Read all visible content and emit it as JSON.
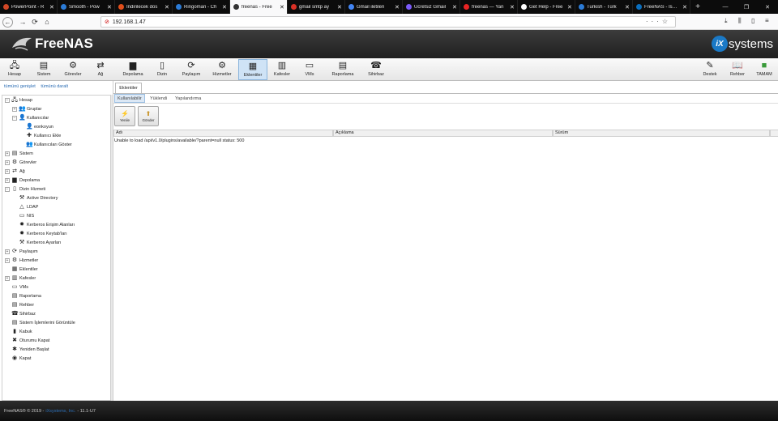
{
  "browser": {
    "tabs": [
      {
        "label": "PowerPoint - R",
        "color": "#d24726",
        "active": false
      },
      {
        "label": "Smooth - Pow",
        "color": "#2b7bd6",
        "active": false
      },
      {
        "label": "İndirilecek dos",
        "color": "#e04e1b",
        "active": false
      },
      {
        "label": "Ringoman - Ch",
        "color": "#2b7bd6",
        "active": false
      },
      {
        "label": "freenas - Free",
        "color": "#333333",
        "active": true
      },
      {
        "label": "gmail smtp ay",
        "color": "#d93025",
        "active": false
      },
      {
        "label": "Gmail iletileri",
        "color": "#4285f4",
        "active": false
      },
      {
        "label": "Ücretsiz Gmail",
        "color": "#7a5af8",
        "active": false
      },
      {
        "label": "freenas — Yan",
        "color": "#e82323",
        "active": false
      },
      {
        "label": "Get Help - Free",
        "color": "#ffffff",
        "active": false
      },
      {
        "label": "Turkish - Türk",
        "color": "#2b7bd6",
        "active": false
      },
      {
        "label": "FreeNAS - İsmail",
        "color": "#0a6ebd",
        "active": false
      }
    ],
    "url": "192.168.1.47"
  },
  "header": {
    "brand": "FreeNAS",
    "vendor": "systems",
    "vendor_mark": "iX"
  },
  "toolbar": {
    "left": [
      {
        "label": "Hesap",
        "icon": "account-icon",
        "glyph": "🖧"
      },
      {
        "label": "Sistem",
        "icon": "system-icon",
        "glyph": "▤"
      },
      {
        "label": "Görevler",
        "icon": "tasks-icon",
        "glyph": "⚙"
      },
      {
        "label": "Ağ",
        "icon": "network-icon",
        "glyph": "⇄"
      },
      {
        "label": "Depolama",
        "icon": "storage-icon",
        "glyph": "▆"
      },
      {
        "label": "Dizin",
        "icon": "directory-icon",
        "glyph": "▯"
      },
      {
        "label": "Paylaşım",
        "icon": "sharing-icon",
        "glyph": "⟳"
      },
      {
        "label": "Hizmetler",
        "icon": "services-icon",
        "glyph": "⚙"
      },
      {
        "label": "Eklentiler",
        "icon": "plugins-icon",
        "glyph": "▦"
      },
      {
        "label": "Kafesler",
        "icon": "jails-icon",
        "glyph": "▥"
      },
      {
        "label": "VMs",
        "icon": "vms-icon",
        "glyph": "▭"
      },
      {
        "label": "Raporlama",
        "icon": "reporting-icon",
        "glyph": "▤"
      },
      {
        "label": "Sihirbaz",
        "icon": "wizard-icon",
        "glyph": "☎"
      }
    ],
    "active": "Eklentiler",
    "right": [
      {
        "label": "Destek",
        "icon": "support-icon",
        "glyph": "✎"
      },
      {
        "label": "Rehber",
        "icon": "guide-icon",
        "glyph": "📖"
      },
      {
        "label": "TAMAM",
        "icon": "ok-icon",
        "glyph": "■"
      }
    ]
  },
  "sidebar": {
    "expand_all": "tümünü genişlet",
    "collapse_all": "tümünü daralt",
    "tree": [
      {
        "label": "Hesap",
        "depth": 0,
        "toggle": "−",
        "icon": "account-icon",
        "glyph": "🖧"
      },
      {
        "label": "Gruplar",
        "depth": 1,
        "toggle": "+",
        "icon": "groups-icon",
        "glyph": "👥"
      },
      {
        "label": "Kullanıcılar",
        "depth": 1,
        "toggle": "−",
        "icon": "users-icon",
        "glyph": "👤"
      },
      {
        "label": "eonkoyun",
        "depth": 2,
        "toggle": "",
        "icon": "user-icon",
        "glyph": "👤"
      },
      {
        "label": "Kullanıcı Ekle",
        "depth": 2,
        "toggle": "",
        "icon": "add-user-icon",
        "glyph": "✚"
      },
      {
        "label": "Kullanıcıları Göster",
        "depth": 2,
        "toggle": "",
        "icon": "list-users-icon",
        "glyph": "👥"
      },
      {
        "label": "Sistem",
        "depth": 0,
        "toggle": "+",
        "icon": "system-icon",
        "glyph": "▤"
      },
      {
        "label": "Görevler",
        "depth": 0,
        "toggle": "+",
        "icon": "tasks-icon",
        "glyph": "⚙"
      },
      {
        "label": "Ağ",
        "depth": 0,
        "toggle": "+",
        "icon": "network-icon",
        "glyph": "⇄"
      },
      {
        "label": "Depolama",
        "depth": 0,
        "toggle": "+",
        "icon": "storage-icon",
        "glyph": "▆"
      },
      {
        "label": "Dizin Hizmeti",
        "depth": 0,
        "toggle": "−",
        "icon": "directory-icon",
        "glyph": "▯"
      },
      {
        "label": "Active Directory",
        "depth": 1,
        "toggle": "",
        "icon": "active-directory-icon",
        "glyph": "⚒"
      },
      {
        "label": "LDAP",
        "depth": 1,
        "toggle": "",
        "icon": "ldap-icon",
        "glyph": "△"
      },
      {
        "label": "NIS",
        "depth": 1,
        "toggle": "",
        "icon": "nis-icon",
        "glyph": "▭"
      },
      {
        "label": "Kerberos Erişim Alanları",
        "depth": 1,
        "toggle": "",
        "icon": "kerberos-icon",
        "glyph": "✹"
      },
      {
        "label": "Kerberos Keytab'ları",
        "depth": 1,
        "toggle": "",
        "icon": "kerberos-icon",
        "glyph": "✹"
      },
      {
        "label": "Kerberos Ayarları",
        "depth": 1,
        "toggle": "",
        "icon": "settings-icon",
        "glyph": "⚒"
      },
      {
        "label": "Paylaşım",
        "depth": 0,
        "toggle": "+",
        "icon": "sharing-icon",
        "glyph": "⟳"
      },
      {
        "label": "Hizmetler",
        "depth": 0,
        "toggle": "+",
        "icon": "services-icon",
        "glyph": "⚙"
      },
      {
        "label": "Eklentiler",
        "depth": 0,
        "toggle": "",
        "icon": "plugins-icon",
        "glyph": "▦"
      },
      {
        "label": "Kafesler",
        "depth": 0,
        "toggle": "+",
        "icon": "jails-icon",
        "glyph": "▥"
      },
      {
        "label": "VMs",
        "depth": 0,
        "toggle": "",
        "icon": "vms-icon",
        "glyph": "▭"
      },
      {
        "label": "Raporlama",
        "depth": 0,
        "toggle": "",
        "icon": "reporting-icon",
        "glyph": "▤"
      },
      {
        "label": "Rehber",
        "depth": 0,
        "toggle": "",
        "icon": "guide-icon",
        "glyph": "▤"
      },
      {
        "label": "Sihirbaz",
        "depth": 0,
        "toggle": "",
        "icon": "wizard-icon",
        "glyph": "☎"
      },
      {
        "label": "Sistem İşlemlerini Görüntüle",
        "depth": 0,
        "toggle": "",
        "icon": "processes-icon",
        "glyph": "▤"
      },
      {
        "label": "Kabuk",
        "depth": 0,
        "toggle": "",
        "icon": "shell-icon",
        "glyph": "▮"
      },
      {
        "label": "Oturumu Kapat",
        "depth": 0,
        "toggle": "",
        "icon": "logout-icon",
        "glyph": "✖"
      },
      {
        "label": "Yeniden Başlat",
        "depth": 0,
        "toggle": "",
        "icon": "reboot-icon",
        "glyph": "✱"
      },
      {
        "label": "Kapat",
        "depth": 0,
        "toggle": "",
        "icon": "shutdown-icon",
        "glyph": "◉"
      }
    ]
  },
  "main": {
    "tab": "Eklentiler",
    "subtabs": [
      "Kullanılabilir",
      "Yüklendi",
      "Yapılandırma"
    ],
    "active_subtab": "Kullanılabilir",
    "buttons": [
      {
        "label": "Yenile",
        "icon": "refresh-icon",
        "glyph": "⚡"
      },
      {
        "label": "Gönder",
        "icon": "upload-icon",
        "glyph": "⬆"
      }
    ],
    "columns": [
      "Adı",
      "Açıklama",
      "Sürüm"
    ],
    "error": "Unable to load /api/v1.0/plugins/available/?parent=null status: 500"
  },
  "footer": {
    "copyright": "FreeNAS® © 2019 -",
    "company": "iXsystems, Inc.",
    "version": "- 11.1-U7"
  },
  "colors": {
    "header_bg": "#2b2b2b",
    "accent": "#2a6cb3",
    "active_toolbar": "#cfe3f6",
    "vendor_logo": "#1a79c6"
  }
}
